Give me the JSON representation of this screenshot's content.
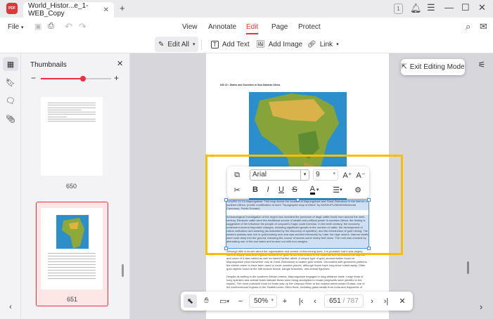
{
  "app": {
    "logo_text": "PDF",
    "tab_title": "World_Histor...e_1-WEB_Copy",
    "page_indicator": "1"
  },
  "menu": {
    "file": "File",
    "tabs": [
      "View",
      "Annotate",
      "Edit",
      "Page",
      "Protect"
    ],
    "active_tab": "Edit"
  },
  "edit_toolbar": {
    "edit_all": "Edit All",
    "add_text": "Add Text",
    "add_image": "Add Image",
    "link": "Link"
  },
  "thumbnails": {
    "title": "Thumbnails",
    "zoom_fraction": 0.6,
    "pages": [
      {
        "label": "650"
      },
      {
        "label": "651",
        "selected": true
      }
    ]
  },
  "exit_editing": "Exit Editing Mode",
  "page": {
    "header": "640   22 • States and Societies in Sub-Saharan Africa",
    "caption": "FIGURE 22.13 Mapungubwe. This map shows the location of Mapungubwe and Great Zimbabwe in the interior of southern Africa. (credit: modification of work \"Topographic map of Africa\" by NASA/JPL/NIMA/Wikimedia Commons, Public Domain)",
    "para1": "Archaeological investigation of the region has revealed the presence of large cattle herds from around the ninth century. Because cattle were the traditional source of wealth and political power in southern Africa, the finding is suggestive of the influence the people of Leopard's Kopje could exercise. In the tenth century, the economy underwent several important changes, including significant growth in the number of cattle, the development of cotton cultivation and weaving (as indicated by the discovery of spindles), and the introduction of gold mining. The western plateau was rich in gold-bearing rock and was worked intensively by Later Iron Age miners. Narrow shafts were sunk deep into the ground, following the course of seams some ninety feet down. The rock was cracked by alternating use of fire and water and broken out with iron wedges.",
    "para2": "Although little is known about the organization and control of this mining work, it is probable that it was largely used to supply local and regional demand for gold, which was traded to the coast as well as crafted into objects, and some of it was traded as well as traded farther afield. A unique type of gold ornamentation found at Mapungubwe (and elsewhere only at Great Zimbabwe) is beaten gold sheets. Decorated with geometric patterns, the sheets seem to have been used to cover wooden pieces, although these have long since rotted away. Other gold objects found at the site include beads, bangle bracelets, and animal figurines.",
    "para3": "Despite its setting in the southern African interior, Mapungubwe engaged in long-distance trade. Large finds of ivory splinters and animal hides indicate these were being stockpiled for trade (elephants were plentiful in the region). The most probable route for trade was up the Limpopo River to the coastal areas toward Sofala, one of the southernmost regions of the Swahili coast. Other finds, including glass beads from India and fragments of"
  },
  "format_toolbar": {
    "font": "Arial",
    "size": "9"
  },
  "bottom_toolbar": {
    "zoom": "50%",
    "current_page": "651",
    "total_pages": "/ 787"
  },
  "colors": {
    "accent": "#e5343d",
    "selection_box": "#f5c000",
    "selection": "#4d90e0"
  }
}
